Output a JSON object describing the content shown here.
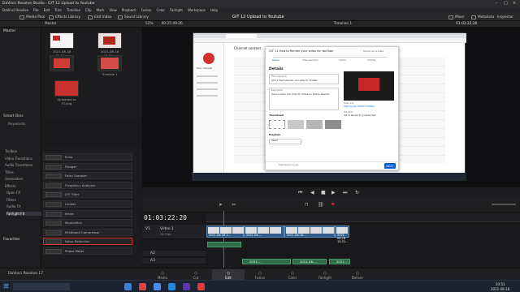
{
  "window": {
    "app_name": "DaVinci Resolve Studio - GIT 12 Upload to Youtube",
    "menu": [
      "DaVinci Resolve",
      "File",
      "Edit",
      "Trim",
      "Timeline",
      "Clip",
      "Mark",
      "View",
      "Playback",
      "Fusion",
      "Color",
      "Fairlight",
      "Workspace",
      "Help"
    ]
  },
  "toolbar": {
    "media_pool": "Media Pool",
    "effects_library": "Effects Library",
    "edit_index": "Edit Index",
    "sound_library": "Sound Library",
    "project_title": "GIT 12 Upload to Youtube",
    "mixer": "Mixer",
    "metadata": "Metadata",
    "inspector": "Inspector"
  },
  "panel": {
    "bin_name": "Master",
    "zoom": "52%",
    "source_tc": "00:25:49:26",
    "timeline_name": "Timeline 1",
    "record_tc": "01:03:22:20"
  },
  "left": {
    "master": "Master",
    "smart_bins": "Smart Bins",
    "keywords": "Keywords"
  },
  "media_pool": {
    "clips": [
      {
        "label": "2021-08-18 15:29..."
      },
      {
        "label": "2021-08-18 15:31..."
      },
      {
        "label": "Timeline 1"
      },
      {
        "label": "Uploaded to YT.png"
      }
    ]
  },
  "fx_tree": {
    "items": [
      "Toolbox",
      "Video Transitions",
      "Audio Transitions",
      "Titles",
      "Generators",
      "Effects",
      "Open FX",
      "Filters",
      "Audio FX",
      "Fairlight FX"
    ],
    "favorites": "Favorites"
  },
  "fx_list": {
    "items": [
      "Echo",
      "Flanger",
      "Foley Sampler",
      "Frequency Analyzer",
      "LFE Filter",
      "Limiter",
      "Meter",
      "Modulation",
      "Multiband Compressor",
      "Noise Reduction",
      "Phase Meter"
    ]
  },
  "browser": {
    "studio_title": "Channel content",
    "channel_label": "Your channel",
    "modal": {
      "header": "GIT 11 How to Render your video for YouTube",
      "saved": "Saved as private",
      "steps": [
        "Details",
        "Video elements",
        "Checks",
        "Visibility"
      ],
      "details_title": "Details",
      "title_label": "Title (required)",
      "title_value": "GIT 11 How to Render your video for YouTube",
      "desc_label": "Description",
      "desc_value": "How to render your video for YouTube in DaVinci Resolve.",
      "video_link_label": "Video link",
      "video_link": "https://youtu.be/9X1h7k0abQc",
      "filename_label": "Filename",
      "filename": "GIT 11 Render for youtube.mp4",
      "thumbnail_label": "Thumbnail",
      "playlists_label": "Playlists",
      "select_label": "Select",
      "next": "NEXT",
      "checks_status": "Checking for issues"
    }
  },
  "timeline": {
    "timecode": "01:03:22:20",
    "tracks": [
      {
        "id": "V1",
        "name": "Video 1",
        "info": "28 Clips"
      },
      {
        "id": "A2",
        "name": "A2"
      },
      {
        "id": "A3",
        "name": "A3"
      }
    ],
    "video_clips": [
      "2021-08-18 1...",
      "2021-08-...",
      "2021-08-18...",
      "2021-08-18 15:31..."
    ],
    "audio_clips": [
      "2021-...",
      "2021-08-...",
      "2021-..."
    ]
  },
  "pages": [
    "Media",
    "Cut",
    "Edit",
    "Fusion",
    "Color",
    "Fairlight",
    "Deliver"
  ],
  "active_page": "Edit",
  "status": {
    "app_version": "DaVinci Resolve 17"
  },
  "taskbar": {
    "time": "20:51",
    "date": "2021-08-18"
  }
}
